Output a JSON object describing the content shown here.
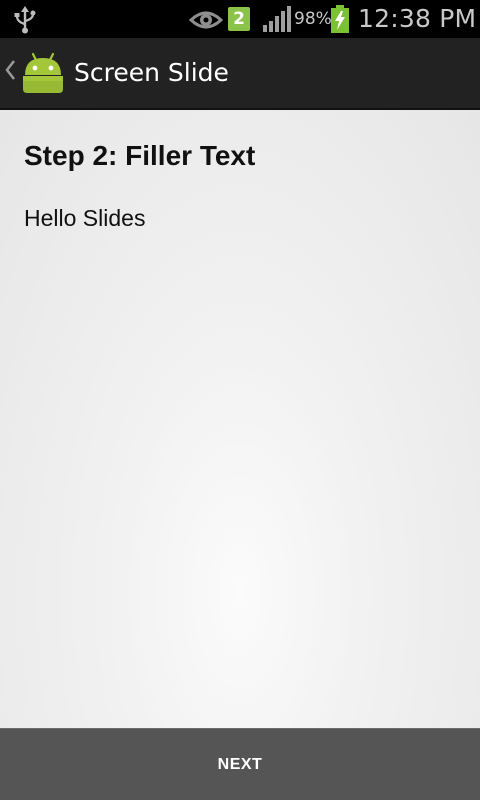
{
  "status_bar": {
    "notification_count": "2",
    "battery_percent": "98%",
    "time": "12:38 PM",
    "icons": [
      "usb-icon",
      "eye-icon",
      "signal-icon",
      "battery-charging-icon"
    ]
  },
  "action_bar": {
    "title": "Screen Slide",
    "icons": [
      "up-caret-icon",
      "android-app-icon"
    ]
  },
  "content": {
    "step_title": "Step 2: Filler Text",
    "body_text": "Hello Slides"
  },
  "bottom_bar": {
    "next_label": "NEXT"
  },
  "colors": {
    "status_bar_bg": "#000000",
    "action_bar_bg": "#222222",
    "content_bg": "#eeeeee",
    "bottom_bar_bg": "#555555",
    "android_green": "#a4c639",
    "notification_green": "#8bc34a"
  }
}
